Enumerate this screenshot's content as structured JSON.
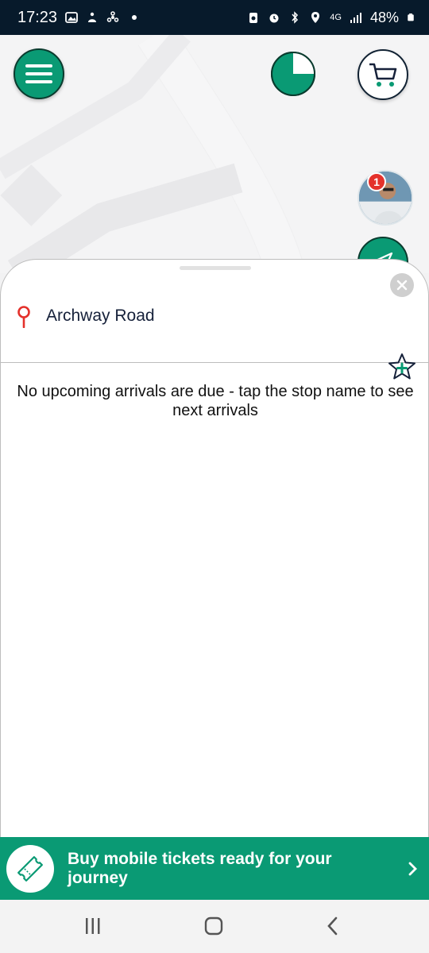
{
  "status_bar": {
    "time": "17:23",
    "network": "4G",
    "battery": "48%"
  },
  "map": {
    "menu_button_icon": "hamburger-icon",
    "timer_icon": "pie-timer-icon",
    "cart_icon": "cart-icon",
    "avatar_icon": "user-avatar",
    "notification_count": "1",
    "navigate_icon": "navigate-arrow-icon"
  },
  "sheet": {
    "stop_name": "Archway Road",
    "empty_message": "No upcoming arrivals are due - tap the stop name to see next arrivals",
    "favorite_icon": "star-add-icon",
    "close_icon": "close-icon"
  },
  "promo": {
    "text": "Buy mobile tickets ready for your journey",
    "icon": "ticket-icon"
  },
  "colors": {
    "brand_green": "#0a9a74",
    "pin_red": "#e4312b",
    "status_bar": "#071a2b"
  }
}
